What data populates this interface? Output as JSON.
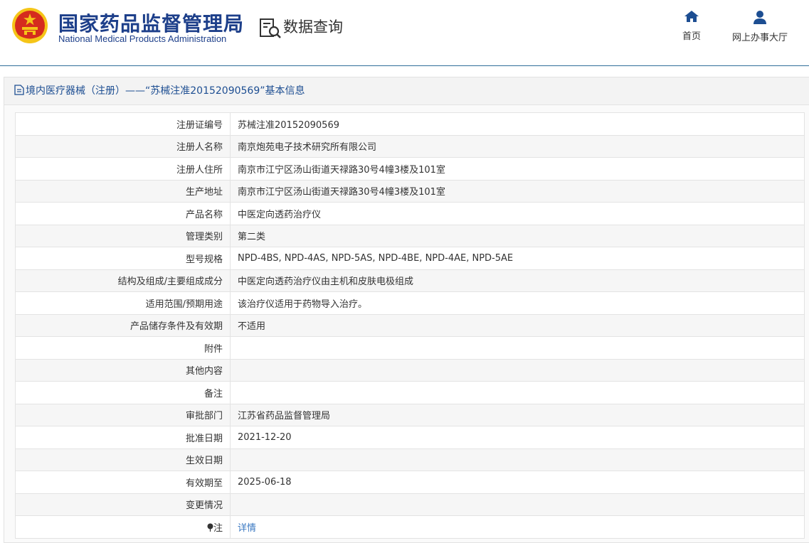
{
  "header": {
    "agency_cn": "国家药品监督管理局",
    "agency_en": "National Medical Products Administration",
    "query_title": "数据查询",
    "nav": [
      {
        "label": "首页",
        "icon": "home-icon"
      },
      {
        "label": "网上办事大厅",
        "icon": "user-icon"
      }
    ]
  },
  "panel": {
    "title": "境内医疗器械（注册）——“苏械注准20152090569”基本信息",
    "title_icon": "document-icon"
  },
  "rows": [
    {
      "label": "注册证编号",
      "value": "苏械注准20152090569"
    },
    {
      "label": "注册人名称",
      "value": "南京炮苑电子技术研究所有限公司"
    },
    {
      "label": "注册人住所",
      "value": "南京市江宁区汤山街道天禄路30号4幢3楼及101室"
    },
    {
      "label": "生产地址",
      "value": "南京市江宁区汤山街道天禄路30号4幢3楼及101室"
    },
    {
      "label": "产品名称",
      "value": "中医定向透药治疗仪"
    },
    {
      "label": "管理类别",
      "value": "第二类"
    },
    {
      "label": "型号规格",
      "value": "NPD-4BS, NPD-4AS, NPD-5AS, NPD-4BE, NPD-4AE, NPD-5AE"
    },
    {
      "label": "结构及组成/主要组成成分",
      "value": "中医定向透药治疗仪由主机和皮肤电极组成"
    },
    {
      "label": "适用范围/预期用途",
      "value": "该治疗仪适用于药物导入治疗。"
    },
    {
      "label": "产品储存条件及有效期",
      "value": "不适用"
    },
    {
      "label": "附件",
      "value": ""
    },
    {
      "label": "其他内容",
      "value": ""
    },
    {
      "label": "备注",
      "value": ""
    },
    {
      "label": "审批部门",
      "value": "江苏省药品监督管理局"
    },
    {
      "label": "批准日期",
      "value": "2021-12-20"
    },
    {
      "label": "生效日期",
      "value": ""
    },
    {
      "label": "有效期至",
      "value": "2025-06-18"
    },
    {
      "label": "变更情况",
      "value": ""
    }
  ],
  "note_row": {
    "label": "注",
    "icon": "pin-icon",
    "link_text": "详情"
  },
  "colors": {
    "brand_blue": "#1d3f8a",
    "link_blue": "#3a78c2",
    "emblem_red": "#d52b1e",
    "emblem_gold": "#f5c518"
  }
}
